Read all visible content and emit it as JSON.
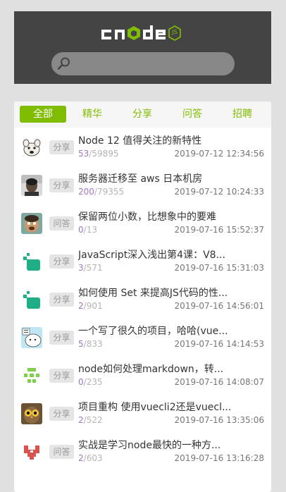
{
  "header": {
    "logo_text": "cnode",
    "logo_badge": "JS",
    "search": {
      "placeholder": "",
      "value": ""
    }
  },
  "tabs": [
    {
      "label": "全部",
      "active": true
    },
    {
      "label": "精华",
      "active": false
    },
    {
      "label": "分享",
      "active": false
    },
    {
      "label": "问答",
      "active": false
    },
    {
      "label": "招聘",
      "active": false
    }
  ],
  "topics": [
    {
      "badge": "分享",
      "title": "Node 12 值得关注的新特性",
      "replies": "53",
      "views": "59895",
      "time": "2019-07-12 12:34:56",
      "avatar": "cartoon-avatar"
    },
    {
      "badge": "分享",
      "title": "服务器迁移至 aws 日本机房",
      "replies": "200",
      "views": "79355",
      "time": "2019-07-12 10:24:33",
      "avatar": "photo-avatar"
    },
    {
      "badge": "问答",
      "title": "保留两位小数，比想象中的要难",
      "replies": "0",
      "views": "13",
      "time": "2019-07-16 15:52:37",
      "avatar": "face-avatar"
    },
    {
      "badge": "分享",
      "title": "JavaScript深入浅出第4课：V8...",
      "replies": "3",
      "views": "571",
      "time": "2019-07-16 15:31:03",
      "avatar": "teal-blob-avatar"
    },
    {
      "badge": "分享",
      "title": "如何使用 Set 来提高JS代码的性...",
      "replies": "2",
      "views": "901",
      "time": "2019-07-16 14:56:01",
      "avatar": "teal-blob-avatar"
    },
    {
      "badge": "分享",
      "title": "一个写了很久的项目，哈哈(vue...",
      "replies": "5",
      "views": "833",
      "time": "2019-07-16 14:14:53",
      "avatar": "comic-avatar"
    },
    {
      "badge": "分享",
      "title": "node如何处理markdown，转...",
      "replies": "0",
      "views": "235",
      "time": "2019-07-16 14:08:07",
      "avatar": "green-pixel-avatar"
    },
    {
      "badge": "分享",
      "title": "项目重构 使用vuecli2还是vuecl...",
      "replies": "2",
      "views": "522",
      "time": "2019-07-16 13:35:06",
      "avatar": "owl-avatar"
    },
    {
      "badge": "问答",
      "title": "实战是学习node最快的一种方...",
      "replies": "2",
      "views": "603",
      "time": "2019-07-16 13:16:28",
      "avatar": "red-pixel-avatar"
    }
  ],
  "colors": {
    "header_bg": "#444444",
    "accent": "#80bd01",
    "badge_bg": "#e5e5e5",
    "badge_text": "#999999"
  }
}
